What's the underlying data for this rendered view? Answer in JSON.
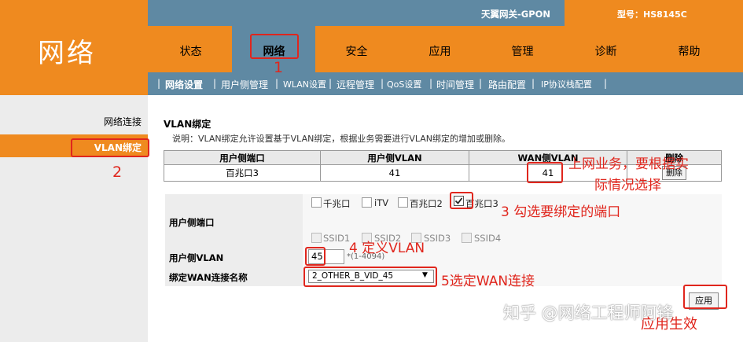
{
  "brand": {
    "title": "网络"
  },
  "header": {
    "product_name": "天翼网关-GPON",
    "model": "型号：HS8145C"
  },
  "nav": {
    "tabs": [
      "状态",
      "网络",
      "安全",
      "应用",
      "管理",
      "诊断",
      "帮助"
    ],
    "active": "网络"
  },
  "subnav": {
    "items": [
      "网络设置",
      "用户侧管理",
      "WLAN设置",
      "远程管理",
      "QoS设置",
      "时间管理",
      "路由配置",
      "IP协议栈配置"
    ]
  },
  "sidebar": {
    "items": [
      "网络连接",
      "VLAN绑定"
    ],
    "active": "VLAN绑定"
  },
  "content": {
    "title": "VLAN绑定",
    "description": "说明：VLAN绑定允许设置基于VLAN绑定，根据业务需要进行VLAN绑定的增加或删除。"
  },
  "table": {
    "headers": [
      "用户侧端口",
      "用户侧VLAN",
      "WAN侧VLAN",
      "删除"
    ],
    "rows": [
      {
        "port": "百兆口3",
        "user_vlan": "41",
        "wan_vlan": "41",
        "action": "删除"
      }
    ]
  },
  "form": {
    "port_label": "用户侧端口",
    "ports": [
      {
        "label": "千兆口",
        "checked": false
      },
      {
        "label": "iTV",
        "checked": false
      },
      {
        "label": "百兆口2",
        "checked": false
      },
      {
        "label": "百兆口3",
        "checked": true
      }
    ],
    "ssids": [
      {
        "label": "SSID1",
        "disabled": true
      },
      {
        "label": "SSID2",
        "disabled": true
      },
      {
        "label": "SSID3",
        "disabled": true
      },
      {
        "label": "SSID4",
        "disabled": true
      }
    ],
    "vlan_label": "用户侧VLAN",
    "vlan_value": "45",
    "vlan_hint": "*(1-4094)",
    "wan_label": "绑定WAN连接名称",
    "wan_value": "2_OTHER_B_VID_45",
    "apply_label": "应用"
  },
  "annotations": {
    "n1": "1",
    "n2": "2",
    "n3": "3 勾选要绑定的端口",
    "n4": "4 定义VLAN",
    "n5": "5选定WAN连接",
    "wan_note_line1": "上网业务，要根据实",
    "wan_note_line2": "际情况选择",
    "apply_note": "应用生效"
  },
  "watermark": "知乎 @网络工程师阿锋",
  "colors": {
    "orange": "#ef8a1f",
    "steel_blue": "#5f89a3",
    "annotation_red": "#e0261d"
  }
}
